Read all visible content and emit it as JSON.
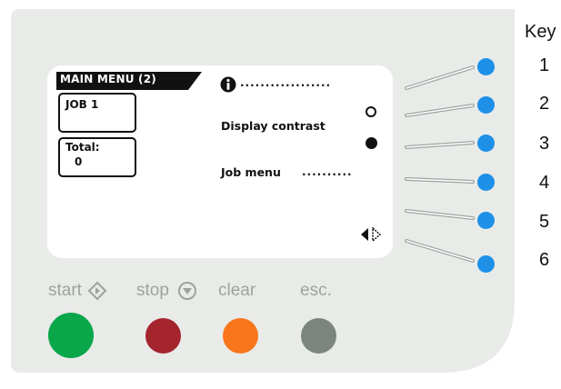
{
  "display": {
    "menu_title": "MAIN MENU (2)",
    "job_box": "JOB   1",
    "total_label": "Total:",
    "total_value": "0",
    "info_dots": "..................",
    "display_contrast": "Display contrast",
    "job_menu": "Job menu",
    "job_menu_dots": ".........."
  },
  "key": {
    "title": "Key",
    "numbers": [
      "1",
      "2",
      "3",
      "4",
      "5",
      "6"
    ],
    "button_color": "#1e90e8"
  },
  "controls": {
    "start_label": "start",
    "stop_label": "stop",
    "clear_label": "clear",
    "esc_label": "esc.",
    "start_color": "#0aa64a",
    "stop_color": "#a5252f",
    "clear_color": "#f9761a",
    "esc_color": "#7b857e"
  },
  "panel_color": "#e9ebe9"
}
